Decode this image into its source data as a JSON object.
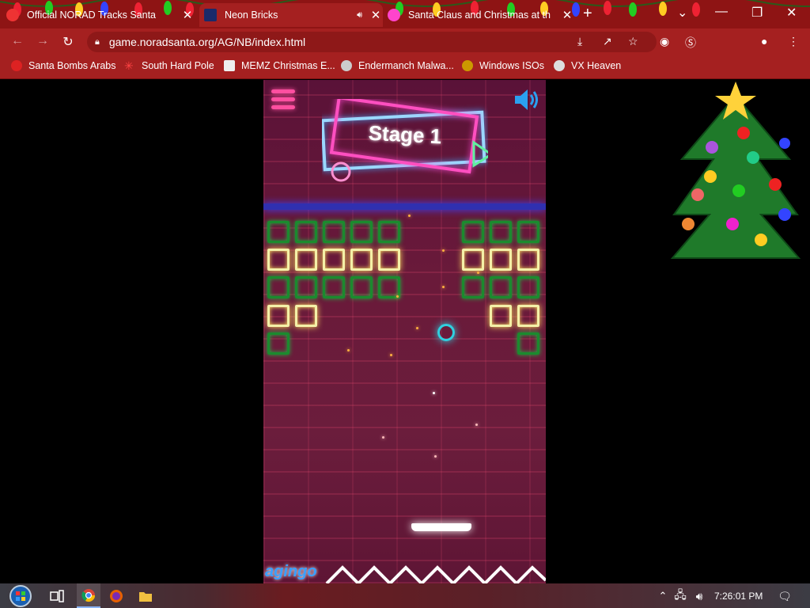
{
  "browser": {
    "tabs": [
      {
        "title": "Official NORAD Tracks Santa",
        "active": false
      },
      {
        "title": "Neon Bricks",
        "active": true
      },
      {
        "title": "Santa Claus and Christmas at the",
        "active": false
      }
    ],
    "url": "game.noradsanta.org/AG/NB/index.html",
    "bookmarks": [
      {
        "label": "Santa Bombs Arabs"
      },
      {
        "label": "South Hard Pole"
      },
      {
        "label": "MEMZ Christmas E..."
      },
      {
        "label": "Endermanch Malwa..."
      },
      {
        "label": "Windows ISOs"
      },
      {
        "label": "VX Heaven"
      }
    ],
    "theme_color": "#a52020"
  },
  "game": {
    "stage_label": "Stage 1",
    "brand": "agingo",
    "accent_colors": {
      "brick": "#1b8a2e",
      "brick_bright": "#f4f0a8",
      "ball": "#30d0e0",
      "hud": "#ff4fa0"
    }
  },
  "taskbar": {
    "clock": "7:26:01 PM",
    "apps": [
      "start-orb-icon",
      "task-view-icon",
      "chrome-icon",
      "firefox-icon",
      "file-explorer-icon"
    ]
  }
}
